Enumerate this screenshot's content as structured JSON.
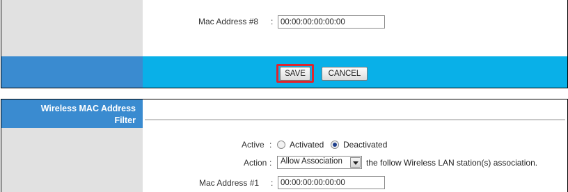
{
  "top_panel": {
    "mac8": {
      "label": "Mac Address #8",
      "value": "00:00:00:00:00:00"
    },
    "buttons": {
      "save": "SAVE",
      "cancel": "CANCEL"
    }
  },
  "bottom_panel": {
    "section_title_line1": "Wireless MAC Address",
    "section_title_line2": "Filter",
    "active": {
      "label": "Active",
      "options": [
        "Activated",
        "Deactivated"
      ],
      "selected": "Deactivated"
    },
    "action": {
      "label": "Action",
      "selected": "Allow Association",
      "note": "the follow Wireless LAN station(s) association."
    },
    "mac1": {
      "label": "Mac Address #1",
      "value": "00:00:00:00:00:00"
    }
  },
  "colors": {
    "sidebar_gray": "#e1e1e1",
    "header_blue": "#3a8bd0",
    "savebar_cyan": "#09b0e8",
    "save_highlight": "#e0252d"
  }
}
